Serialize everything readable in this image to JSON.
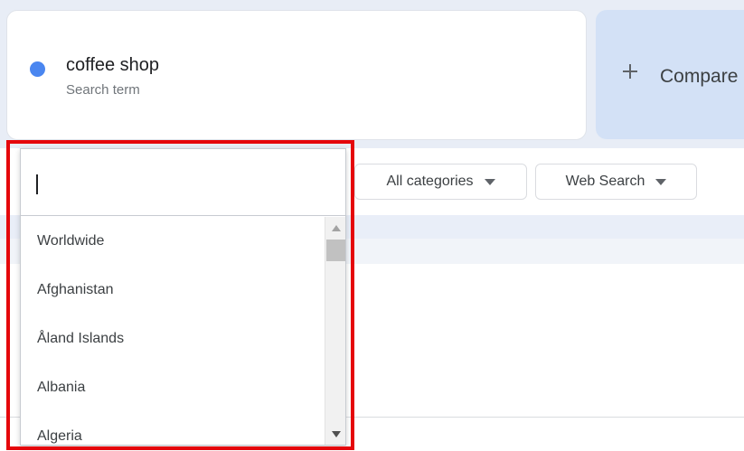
{
  "term_card": {
    "term": "coffee shop",
    "subtitle": "Search term",
    "dot_color": "#4a86f0"
  },
  "compare": {
    "label": "Compare",
    "icon": "plus-icon"
  },
  "filters": {
    "category": "All categories",
    "search_type": "Web Search"
  },
  "location_dropdown": {
    "search_value": "",
    "items": [
      "Worldwide",
      "Afghanistan",
      "Åland Islands",
      "Albania",
      "Algeria"
    ]
  },
  "colors": {
    "accent_dot": "#4a86f0",
    "highlight": "#e5060b",
    "compare_bg": "#d3e1f6"
  }
}
